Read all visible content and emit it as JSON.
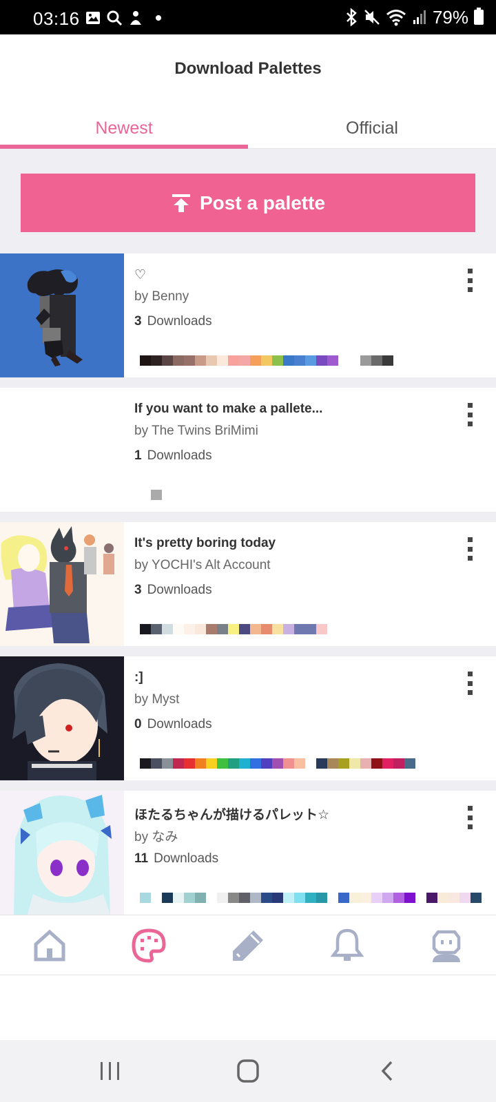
{
  "status_bar": {
    "time": "03:16",
    "battery": "79%"
  },
  "header": {
    "title": "Download Palettes"
  },
  "tabs": [
    {
      "label": "Newest",
      "active": true
    },
    {
      "label": "Official",
      "active": false
    }
  ],
  "post_button": {
    "label": "Post a palette"
  },
  "downloads_label": "Downloads",
  "palettes": [
    {
      "title": "♡",
      "author": "by Benny",
      "downloads": "3",
      "thumb_bg": "#3d73c6",
      "swatches": [
        "#1e1414",
        "#2e2222",
        "#5a4444",
        "#8a6a62",
        "#98706a",
        "#c89a88",
        "#e8c8b0",
        "#fbe9dc",
        "#f7a29c",
        "#f4a8a6",
        "#f4a05a",
        "#f4c860",
        "#8cc04a",
        "#3a78c8",
        "#4a80d0",
        "#5a9ae0",
        "#7a4ac0",
        "#a05ad0",
        "#ffffff",
        "#ffffff",
        "#9a9a9a",
        "#6a6a6a",
        "#3a3a3a"
      ]
    },
    {
      "title": "If you want to make a pallete...",
      "author": "by The Twins BriMimi",
      "downloads": "1",
      "thumb_bg": "#ffffff",
      "swatches": [
        "#ffffff",
        "#aaaaaa"
      ]
    },
    {
      "title": "It's pretty boring today",
      "author": "by  YOCHI's Alt Account",
      "downloads": "3",
      "thumb_bg": "#fdf6ee",
      "swatches": [
        "#181820",
        "#5a6270",
        "#d0dce0",
        "#fefaf6",
        "#fdf0e8",
        "#fbe8dc",
        "#a87c6c",
        "#7a8088",
        "#f8f080",
        "#4c4a80",
        "#f4b890",
        "#e88c70",
        "#f8e0a0",
        "#c8b0e0",
        "#7078b0",
        "#7078b0",
        "#f8c8c8"
      ]
    },
    {
      "title": ":]",
      "author": "by Myst",
      "downloads": "0",
      "thumb_bg": "#1a1a26",
      "swatches": [
        "#1a1a20",
        "#4a5060",
        "#8a9098",
        "#c02850",
        "#e83030",
        "#f08020",
        "#f8d020",
        "#40c040",
        "#20a080",
        "#20b0d0",
        "#3070e0",
        "#5040c0",
        "#a050b0",
        "#f09090",
        "#f8c0a0",
        "#ffffff",
        "#2a3a5a",
        "#a88858",
        "#a8a020",
        "#f0e8a8",
        "#e8b0b0",
        "#901018",
        "#e02060",
        "#c02060",
        "#4a6a8a"
      ]
    },
    {
      "title": "ほたるちゃんが描けるパレット☆",
      "author": "by なみ",
      "downloads": "11",
      "thumb_bg": "#f6f0f8",
      "swatches": [
        "#a8d8e0",
        "#ffffff",
        "#1a3a58",
        "#e8f4f4",
        "#a0d0d0",
        "#80b0b0",
        "#ffffff",
        "#f0f0f0",
        "#888888",
        "#606068",
        "#b0b8c8",
        "#2a4a88",
        "#2a3a78",
        "#c0f0f8",
        "#80e0f0",
        "#30b0c0",
        "#2898a8",
        "#ffffff",
        "#3a68c8",
        "#f8f0d8",
        "#fbf0e0",
        "#e8d0f8",
        "#d0a8f0",
        "#b060e0",
        "#8010d0",
        "#ffffff",
        "#4a1868",
        "#f8ecd8",
        "#f8e8e0",
        "#f0d8f0",
        "#284868"
      ]
    }
  ]
}
